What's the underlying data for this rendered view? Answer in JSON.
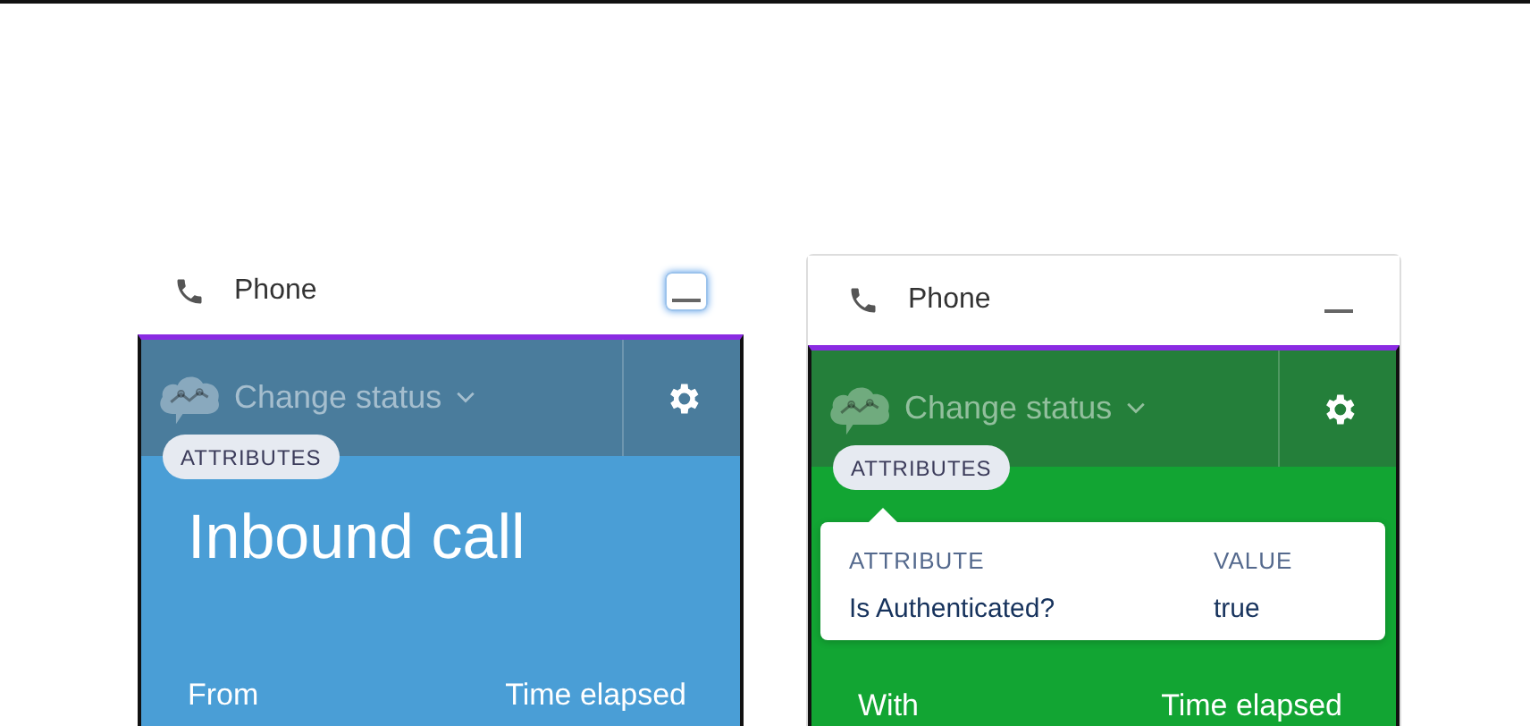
{
  "panels": [
    {
      "title": "Phone",
      "minimize_focused": true,
      "color": "#4a9ed6",
      "status_label": "Change status",
      "badge": "ATTRIBUTES",
      "heading": "Inbound call",
      "fields": [
        "From",
        "Time elapsed"
      ]
    },
    {
      "title": "Phone",
      "minimize_focused": false,
      "color": "#12a533",
      "status_label": "Change status",
      "badge": "ATTRIBUTES",
      "popover": {
        "columns": [
          "ATTRIBUTE",
          "VALUE"
        ],
        "row": [
          "Is Authenticated?",
          "true"
        ]
      },
      "fields": [
        "With",
        "Time elapsed"
      ]
    }
  ]
}
